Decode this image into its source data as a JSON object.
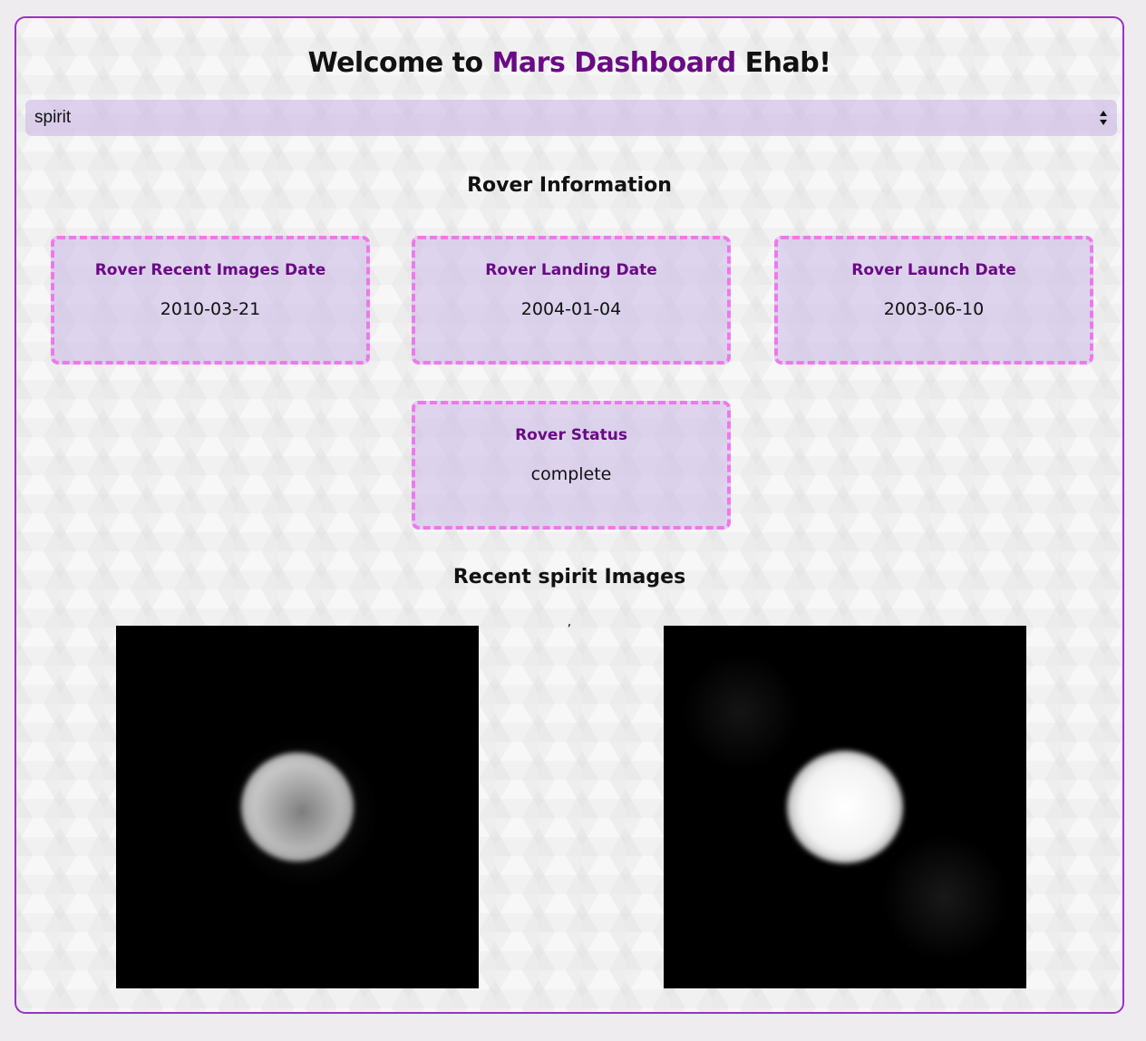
{
  "header": {
    "title_prefix": "Welcome to ",
    "title_accent": "Mars Dashboard",
    "title_suffix": " Ehab!",
    "accent_color": "#6a0a84"
  },
  "rover_select": {
    "selected": "spirit"
  },
  "info_section": {
    "heading": "Rover Information",
    "cards": [
      {
        "label": "Rover Recent Images Date",
        "value": "2010-03-21"
      },
      {
        "label": "Rover Landing Date",
        "value": "2004-01-04"
      },
      {
        "label": "Rover Launch Date",
        "value": "2003-06-10"
      },
      {
        "label": "Rover Status",
        "value": "complete"
      }
    ]
  },
  "images_section": {
    "heading": "Recent spirit Images",
    "separator": ","
  },
  "colors": {
    "frame_border": "#9b30c9",
    "card_border": "#ee78ec",
    "card_fill": "#cfbee9",
    "label": "#6a0a84"
  }
}
